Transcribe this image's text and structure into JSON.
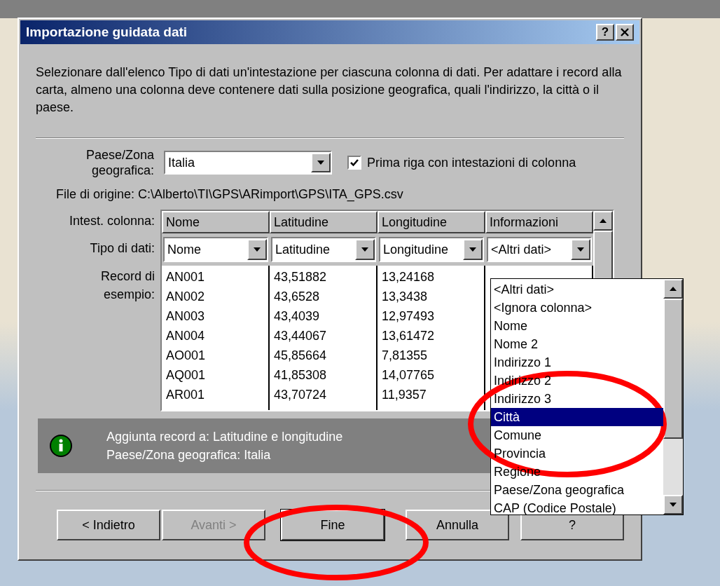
{
  "window": {
    "title": "Importazione guidata dati",
    "help_button": "?"
  },
  "instructions": "Selezionare dall'elenco Tipo di dati un'intestazione per ciascuna colonna di dati. Per adattare i record alla carta, almeno una colonna deve contenere dati sulla posizione geografica, quali l'indirizzo, la città o il paese.",
  "country": {
    "label": "Paese/Zona geografica:",
    "value": "Italia"
  },
  "header_checkbox": {
    "label": "Prima riga con intestazioni di colonna",
    "checked": true
  },
  "source_file": "File di origine: C:\\Alberto\\TI\\GPS\\ARimport\\GPS\\ITA_GPS.csv",
  "table": {
    "header_label": "Intest. colonna:",
    "type_label": "Tipo di dati:",
    "records_label": "Record di esempio:",
    "columns": [
      {
        "header": "Nome",
        "type": "Nome"
      },
      {
        "header": "Latitudine",
        "type": "Latitudine"
      },
      {
        "header": "Longitudine",
        "type": "Longitudine"
      },
      {
        "header": "Informazioni",
        "type": "<Altri dati>"
      }
    ],
    "rows": [
      [
        "AN001",
        "43,51882",
        "13,24168"
      ],
      [
        "AN002",
        "43,6528",
        "13,3438"
      ],
      [
        "AN003",
        "43,4039",
        "12,97493"
      ],
      [
        "AN004",
        "43,44067",
        "13,61472"
      ],
      [
        "AO001",
        "45,85664",
        "7,81355"
      ],
      [
        "AQ001",
        "41,85308",
        "14,07765"
      ],
      [
        "AR001",
        "43,70724",
        "11,9357"
      ]
    ]
  },
  "type_dropdown": {
    "items": [
      {
        "label": "<Altri dati>",
        "selected": false
      },
      {
        "label": "<Ignora colonna>",
        "selected": false
      },
      {
        "label": "Nome",
        "selected": false
      },
      {
        "label": "Nome 2",
        "selected": false
      },
      {
        "label": "Indirizzo 1",
        "selected": false
      },
      {
        "label": "Indirizzo 2",
        "selected": false
      },
      {
        "label": "Indirizzo 3",
        "selected": false
      },
      {
        "label": "Città",
        "selected": true
      },
      {
        "label": "Comune",
        "selected": false
      },
      {
        "label": "Provincia",
        "selected": false
      },
      {
        "label": "Regione",
        "selected": false
      },
      {
        "label": "Paese/Zona geografica",
        "selected": false
      },
      {
        "label": "CAP (Codice Postale)",
        "selected": false
      }
    ]
  },
  "info": {
    "lines": [
      "Aggiunta record a: Latitudine e longitudine",
      "Paese/Zona geografica: Italia"
    ]
  },
  "buttons": [
    {
      "label": "< Indietro",
      "disabled": false
    },
    {
      "label": "Avanti >",
      "disabled": true
    },
    {
      "label": "Fine",
      "disabled": false
    },
    {
      "label": "Annulla",
      "disabled": false
    },
    {
      "label": "?",
      "disabled": false
    }
  ]
}
